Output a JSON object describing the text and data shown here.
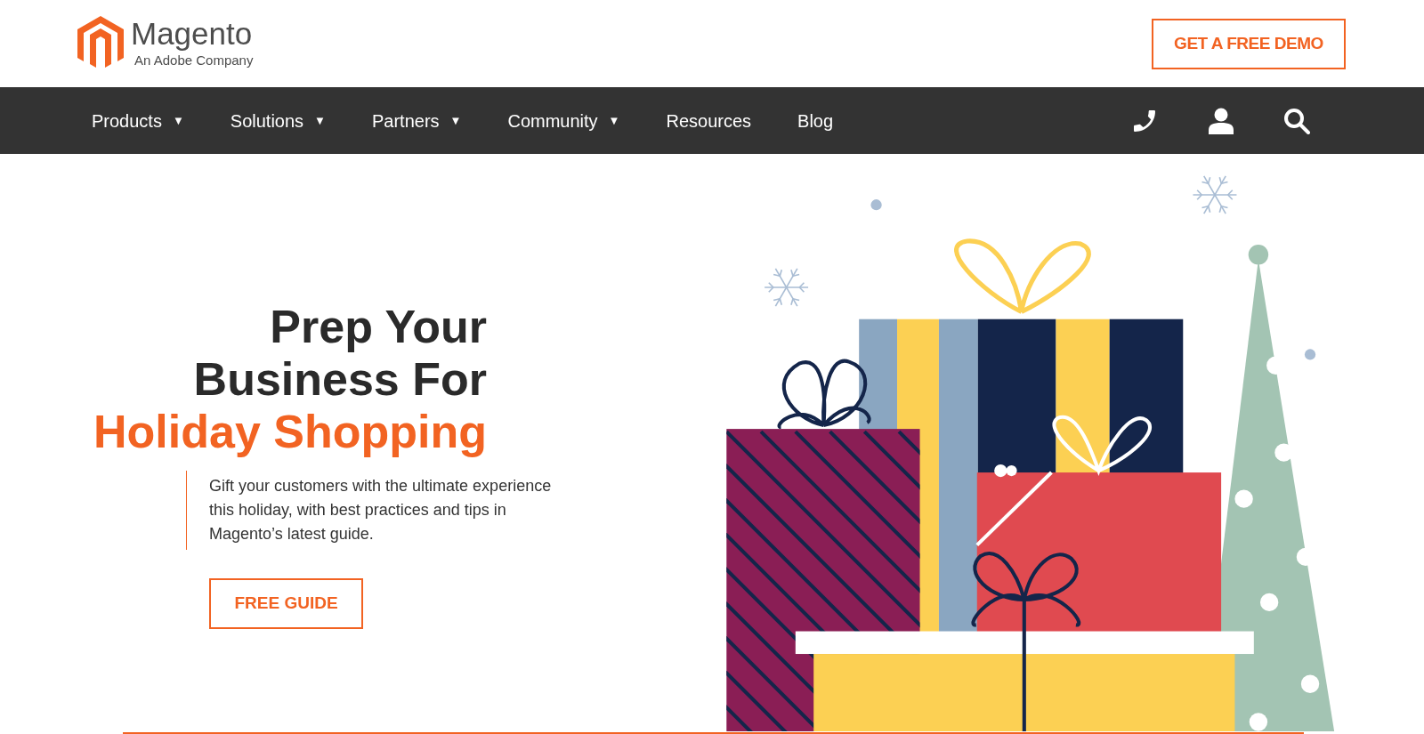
{
  "header": {
    "logo": {
      "name": "Magento",
      "tagline": "An Adobe Company"
    },
    "demo_button": "GET A FREE DEMO"
  },
  "nav": {
    "items": [
      {
        "label": "Products",
        "has_dropdown": true
      },
      {
        "label": "Solutions",
        "has_dropdown": true
      },
      {
        "label": "Partners",
        "has_dropdown": true
      },
      {
        "label": "Community",
        "has_dropdown": true
      },
      {
        "label": "Resources",
        "has_dropdown": false
      },
      {
        "label": "Blog",
        "has_dropdown": false
      }
    ],
    "dropdown_marker": "▼"
  },
  "hero": {
    "title_lines": [
      {
        "text": "Prep Your",
        "kind": "plain"
      },
      {
        "text": "Business For",
        "kind": "plain"
      },
      {
        "text": "Holiday Shopping",
        "kind": "accent"
      }
    ],
    "description": "Gift your customers with the ultimate experience this holiday, with best practices and tips in Magento’s latest guide.",
    "button": "FREE GUIDE"
  }
}
